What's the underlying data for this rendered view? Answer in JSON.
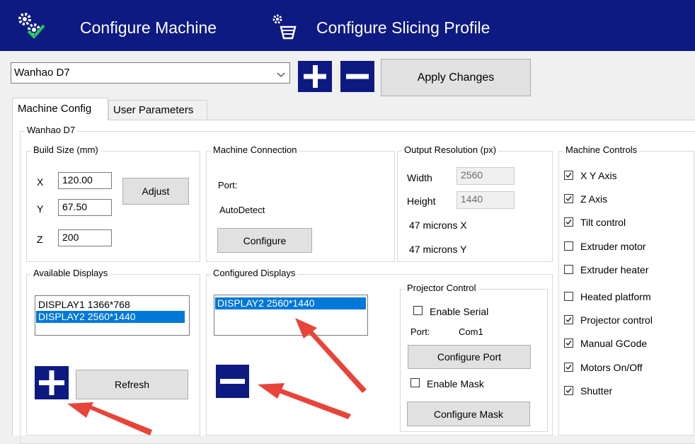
{
  "header": {
    "machine_title": "Configure Machine",
    "profile_title": "Configure Slicing Profile"
  },
  "toolbar": {
    "machine_select_value": "Wanhao D7",
    "apply_label": "Apply Changes"
  },
  "tabs": [
    {
      "label": "Machine Config"
    },
    {
      "label": "User Parameters"
    }
  ],
  "machine_group": {
    "title": "Wanhao D7"
  },
  "build_size": {
    "title": "Build Size (mm)",
    "x_label": "X",
    "x_value": "120.00",
    "y_label": "Y",
    "y_value": "67.50",
    "z_label": "Z",
    "z_value": "200",
    "adjust_label": "Adjust"
  },
  "connection": {
    "title": "Machine Connection",
    "port_label": "Port:",
    "port_value": "AutoDetect",
    "configure_label": "Configure"
  },
  "resolution": {
    "title": "Output Resolution (px)",
    "width_label": "Width",
    "width_value": "2560",
    "height_label": "Height",
    "height_value": "1440",
    "microns_x": "47 microns X",
    "microns_y": "47 microns Y"
  },
  "controls": {
    "title": "Machine Controls",
    "items": [
      {
        "label": "X Y Axis",
        "checked": true
      },
      {
        "label": "Z Axis",
        "checked": true
      },
      {
        "label": "Tilt control",
        "checked": true
      },
      {
        "label": "Extruder motor",
        "checked": false
      },
      {
        "label": "Extruder heater",
        "checked": false
      },
      {
        "label": "Heated platform",
        "checked": false
      },
      {
        "label": "Projector control",
        "checked": true
      },
      {
        "label": "Manual GCode",
        "checked": true
      },
      {
        "label": "Motors On/Off",
        "checked": true
      },
      {
        "label": "Shutter",
        "checked": true
      }
    ]
  },
  "available": {
    "title": "Available Displays",
    "items": [
      "DISPLAY1 1366*768",
      "DISPLAY2 2560*1440"
    ],
    "selected_index": 1,
    "refresh_label": "Refresh"
  },
  "configured": {
    "title": "Configured Displays",
    "items": [
      "DISPLAY2 2560*1440"
    ],
    "selected_index": 0
  },
  "projector": {
    "title": "Projector Control",
    "enable_serial_label": "Enable Serial",
    "enable_serial_checked": false,
    "port_label": "Port:",
    "port_value": "Com1",
    "configure_port_label": "Configure Port",
    "enable_mask_label": "Enable Mask",
    "enable_mask_checked": false,
    "configure_mask_label": "Configure Mask"
  },
  "colors": {
    "header_bg": "#0d1a82",
    "selection": "#0078d7",
    "annotation_arrow": "#e8443a"
  }
}
